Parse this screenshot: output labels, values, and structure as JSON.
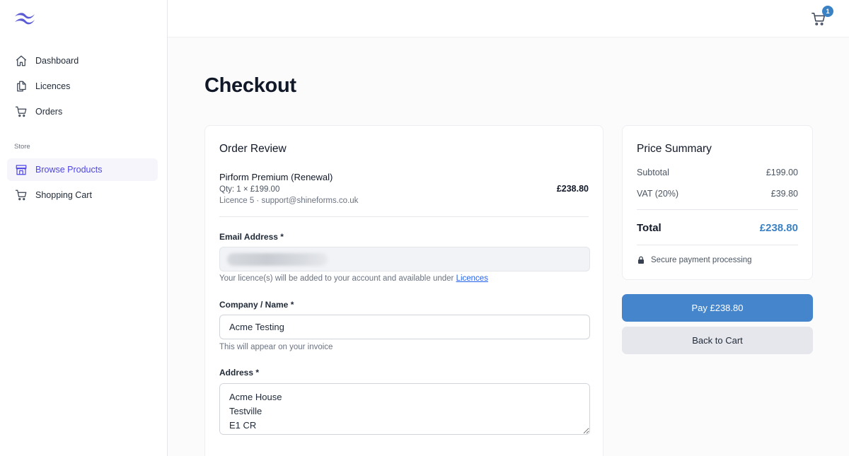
{
  "sidebar": {
    "items": [
      {
        "label": "Dashboard",
        "icon": "home-icon"
      },
      {
        "label": "Licences",
        "icon": "documents-icon"
      },
      {
        "label": "Orders",
        "icon": "cart-icon"
      }
    ],
    "section_label": "Store",
    "store_items": [
      {
        "label": "Browse Products",
        "icon": "storefront-icon",
        "active": true
      },
      {
        "label": "Shopping Cart",
        "icon": "cart-icon"
      }
    ]
  },
  "header": {
    "cart_count": "1"
  },
  "page": {
    "title": "Checkout"
  },
  "order_review": {
    "title": "Order Review",
    "product_name": "Pirform Premium (Renewal)",
    "product_qty": "Qty: 1 × £199.00",
    "product_licence": "Licence 5 · support@shineforms.co.uk",
    "product_price": "£238.80"
  },
  "form": {
    "email_label": "Email Address *",
    "email_help_prefix": "Your licence(s) will be added to your account and available under ",
    "email_help_link": "Licences",
    "company_label": "Company / Name *",
    "company_value": "Acme Testing",
    "company_help": "This will appear on your invoice",
    "address_label": "Address *",
    "address_value": "Acme House\nTestville\nE1 CR"
  },
  "summary": {
    "title": "Price Summary",
    "subtotal_label": "Subtotal",
    "subtotal_value": "£199.00",
    "vat_label": "VAT (20%)",
    "vat_value": "£39.80",
    "total_label": "Total",
    "total_value": "£238.80",
    "secure_text": "Secure payment processing"
  },
  "actions": {
    "pay_label": "Pay £238.80",
    "back_label": "Back to Cart"
  },
  "colors": {
    "accent": "#4585cc",
    "active_nav": "#4f46e5",
    "badge": "#3b82c4"
  }
}
